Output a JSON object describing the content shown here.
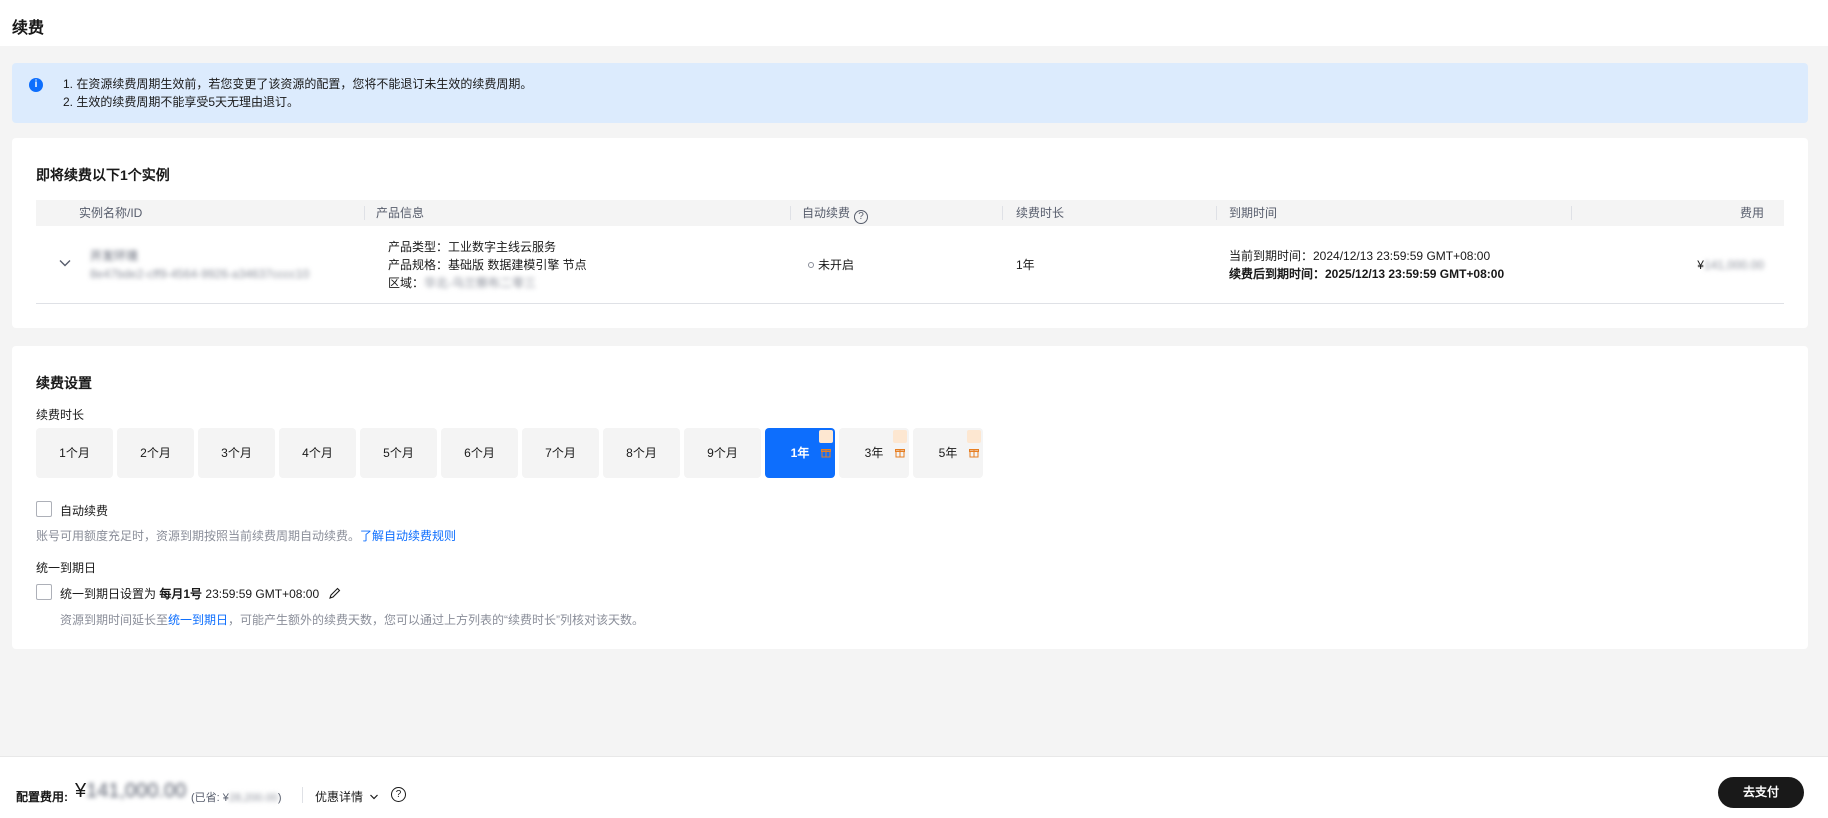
{
  "page": {
    "title": "续费"
  },
  "notice": {
    "line1": "1. 在资源续费周期生效前，若您变更了该资源的配置，您将不能退订未生效的续费周期。",
    "line2": "2. 生效的续费周期不能享受5天无理由退订。"
  },
  "instances": {
    "title": "即将续费以下1个实例",
    "columns": {
      "name": "实例名称/ID",
      "product": "产品信息",
      "auto_renew": "自动续费",
      "duration": "续费时长",
      "expiry": "到期时间",
      "fee": "费用"
    },
    "rows": [
      {
        "name": "开发环境",
        "id": "8e47bde2-cff9-4564-9926-a34637cccc10",
        "product_type": "产品类型：工业数字主线云服务",
        "product_spec": "产品规格：基础版 数据建模引擎 节点",
        "region_label": "区域：",
        "region_value": "华北-乌兰察布二零三",
        "auto_renew": "未开启",
        "duration": "1年",
        "current_expiry": "当前到期时间：2024/12/13 23:59:59 GMT+08:00",
        "new_expiry": "续费后到期时间：2025/12/13 23:59:59 GMT+08:00",
        "fee_currency": "¥",
        "fee_value": "141,000.00"
      }
    ]
  },
  "settings": {
    "title": "续费设置",
    "duration_label": "续费时长",
    "durations": [
      "1个月",
      "2个月",
      "3个月",
      "4个月",
      "5个月",
      "6个月",
      "7个月",
      "8个月",
      "9个月",
      "1年",
      "3年",
      "5年"
    ],
    "selected_duration": "1年",
    "auto_renew_label": "自动续费",
    "auto_renew_hint": "账号可用额度充足时，资源到期按照当前续费周期自动续费。",
    "auto_renew_link": "了解自动续费规则",
    "unify_label": "统一到期日",
    "unify_text_prefix": "统一到期日设置为",
    "unify_day": "每月1号",
    "unify_time": "23:59:59 GMT+08:00",
    "unify_hint_prefix": "资源到期时间延长至",
    "unify_hint_link": "统一到期日",
    "unify_hint_suffix": "，可能产生额外的续费天数，您可以通过上方列表的“续费时长”列核对该天数。"
  },
  "footer": {
    "config_fee_label": "配置费用:",
    "currency": "¥",
    "price": "141,000.00",
    "saved_prefix": "(已省: ¥",
    "saved_value": "28,200.00",
    "saved_suffix": ")",
    "discount_label": "优惠详情",
    "pay_button": "去支付"
  },
  "colors": {
    "accent": "#0d6efd",
    "notice_bg": "#dcebfd",
    "pay_button": "#191919"
  }
}
